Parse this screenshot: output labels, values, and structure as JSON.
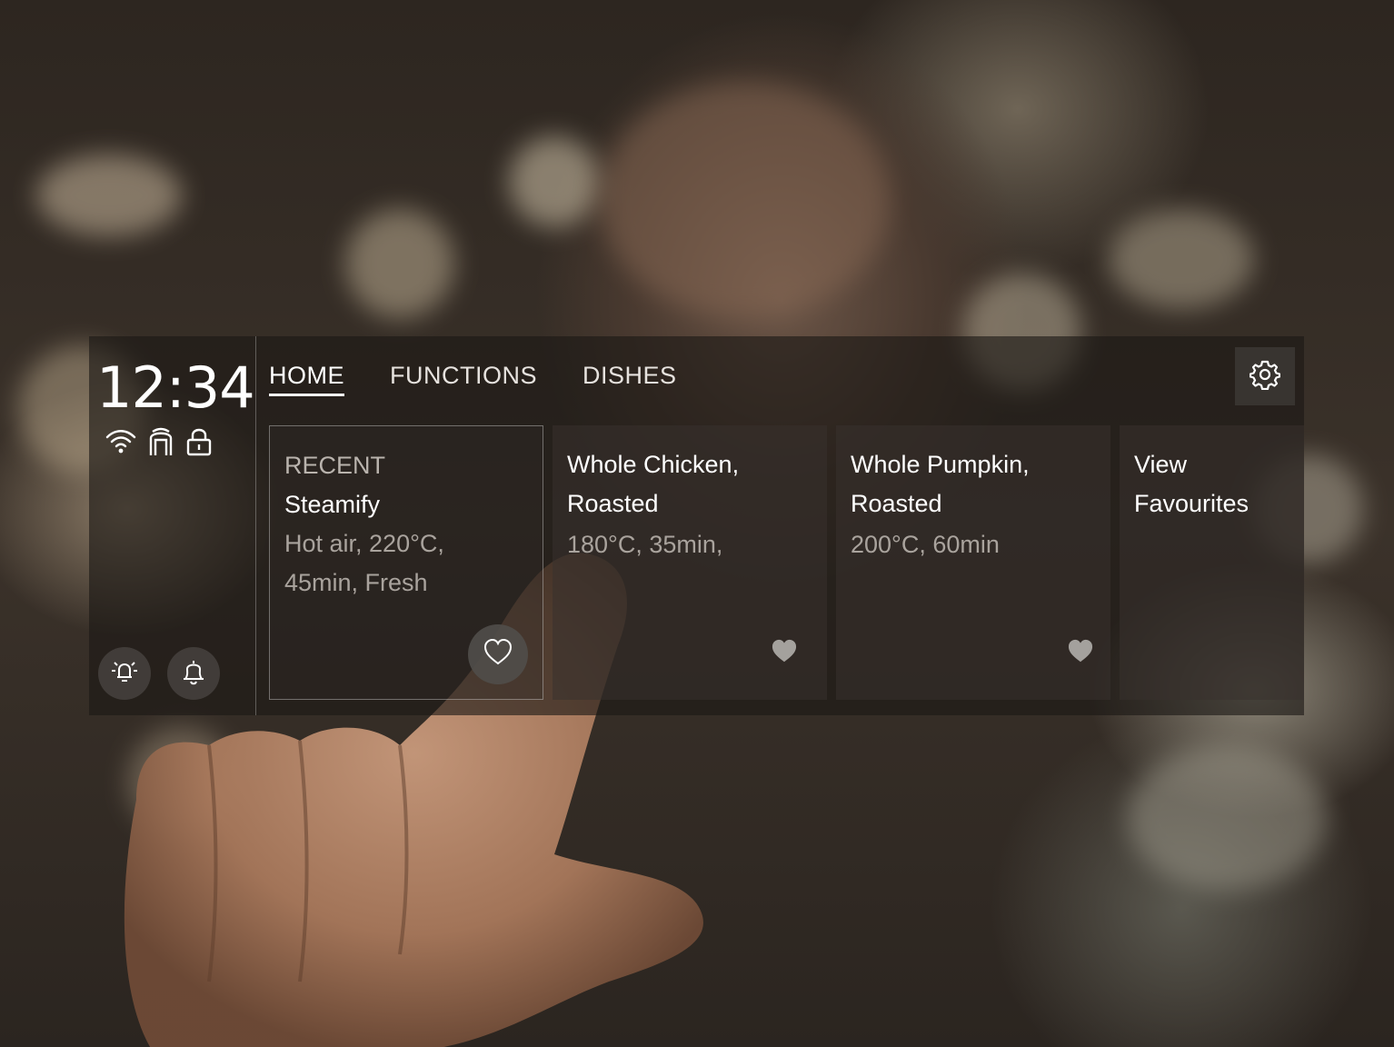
{
  "clock": {
    "time": "12:34"
  },
  "status_icons": [
    "wifi-icon",
    "oven-door-icon",
    "lock-icon"
  ],
  "quick_buttons": [
    "light-icon",
    "bell-icon"
  ],
  "tabs": [
    {
      "label": "HOME",
      "active": true
    },
    {
      "label": "FUNCTIONS",
      "active": false
    },
    {
      "label": "DISHES",
      "active": false
    }
  ],
  "cards": {
    "recent": {
      "kicker": "RECENT",
      "title": "Steamify",
      "sub_line1": "Hot air, 220°C,",
      "sub_line2": "45min, Fresh"
    },
    "chicken": {
      "title_line1": "Whole Chicken,",
      "title_line2": "Roasted",
      "sub": "180°C, 35min,"
    },
    "pumpkin": {
      "title_line1": "Whole Pumpkin,",
      "title_line2": "Roasted",
      "sub": "200°C, 60min"
    },
    "favourites": {
      "title_line1": "View",
      "title_line2": "Favourites"
    }
  },
  "colors": {
    "panel": "#1c1815",
    "text": "#ffffff",
    "muted": "#a9a39d"
  }
}
